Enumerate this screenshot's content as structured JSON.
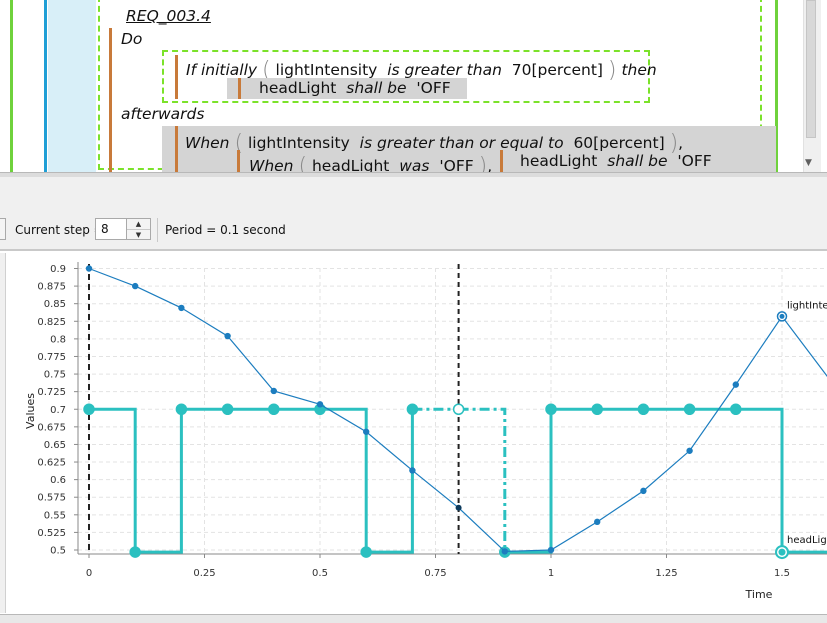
{
  "requirement": {
    "id": "REQ_003.4",
    "do": "Do",
    "line_if_initially": "If initially",
    "subject1": "lightIntensity",
    "rel1": "is greater than",
    "val1": "70[percent]",
    "then": "then",
    "subject2": "headLight",
    "shall_be": "shall be",
    "val2": "'OFF",
    "afterwards": "afterwards",
    "when": "When",
    "subject3": "lightIntensity",
    "rel3": "is greater than or equal to",
    "val3": "60[percent]",
    "comma": ",",
    "when2": "When",
    "subject4": "headLight",
    "was": "was",
    "val4": "'OFF",
    "comma2": ",",
    "subject5": "headLight",
    "shall_be2": "shall be",
    "val5": "'OFF"
  },
  "toolbar": {
    "current_step_label": "Current step =",
    "current_step_value": "8",
    "period_label": "Period = 0.1 second"
  },
  "colors": {
    "light_series": "#1c7dbf",
    "head_series": "#2bc0c0",
    "grid": "#e3e3e3",
    "dash_green": "#7be22a"
  },
  "chart_data": {
    "type": "line",
    "xlabel": "Time",
    "ylabel": "Values",
    "xlim": [
      -0.05,
      1.6
    ],
    "ylim": [
      0.49,
      0.905
    ],
    "x_ticks": [
      "0",
      "0.25",
      "0.5",
      "0.75",
      "1",
      "1.25",
      "1.5"
    ],
    "y_ticks": [
      "0.9",
      "0.875",
      "0.85",
      "0.825",
      "0.8",
      "0.775",
      "0.75",
      "0.725",
      "0.7",
      "0.675",
      "0.65",
      "0.625",
      "0.6",
      "0.575",
      "0.55",
      "0.525",
      "0.5"
    ],
    "current_step_time": 0.8,
    "series": [
      {
        "name": "lightIntensity",
        "label": "lightInte",
        "x": [
          0,
          0.1,
          0.2,
          0.3,
          0.4,
          0.5,
          0.6,
          0.7,
          0.8,
          0.9,
          1.0,
          1.1,
          1.2,
          1.3,
          1.4,
          1.5,
          1.6
        ],
        "y": [
          0.9,
          0.875,
          0.844,
          0.804,
          0.726,
          0.707,
          0.668,
          0.613,
          0.56,
          0.498,
          0.5,
          0.54,
          0.584,
          0.641,
          0.735,
          0.832,
          0.745
        ]
      },
      {
        "name": "headLight",
        "label": "headLig",
        "step": true,
        "x": [
          0,
          0.1,
          0.2,
          0.3,
          0.4,
          0.5,
          0.6,
          0.7,
          0.8,
          0.9,
          1.0,
          1.1,
          1.2,
          1.3,
          1.4,
          1.5,
          1.6
        ],
        "y": [
          0.7,
          0.497,
          0.7,
          0.7,
          0.7,
          0.7,
          0.497,
          0.7,
          0.7,
          0.497,
          0.7,
          0.7,
          0.7,
          0.7,
          0.7,
          0.497,
          0.497
        ],
        "dashed_from": 0.7,
        "dashed_to": 0.9
      }
    ]
  }
}
